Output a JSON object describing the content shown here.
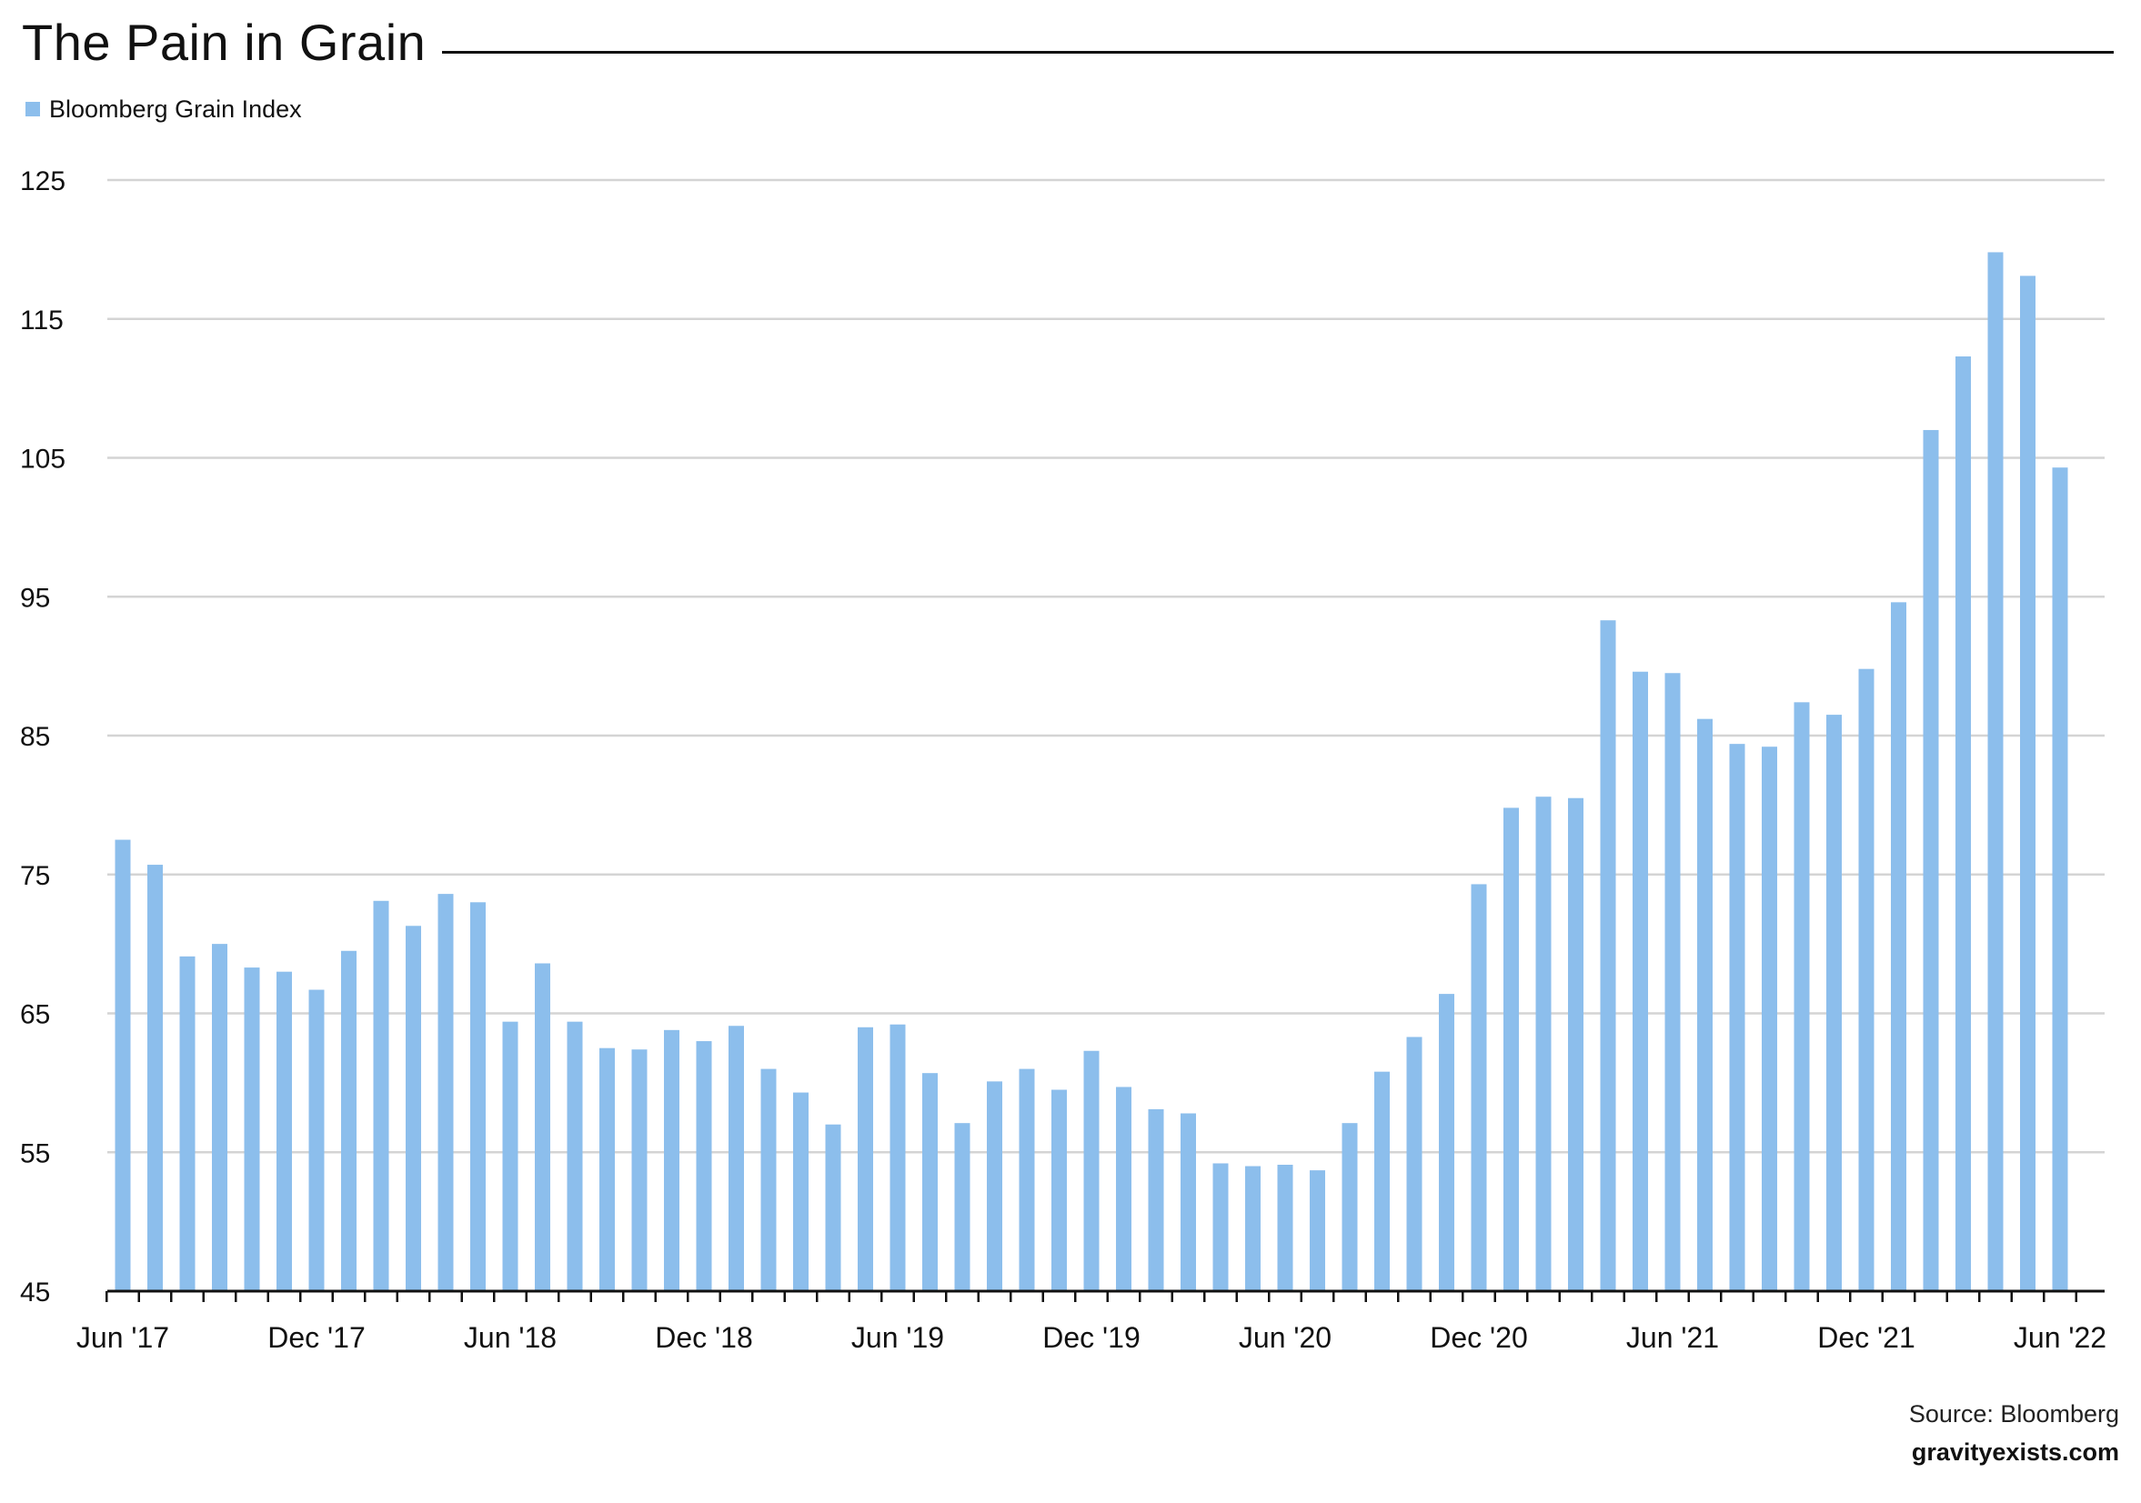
{
  "header": {
    "title": "The Pain in Grain"
  },
  "legend": {
    "label": "Bloomberg Grain Index"
  },
  "footer": {
    "source": "Source: Bloomberg",
    "site": "gravityexists.com"
  },
  "colors": {
    "bar": "#8cbeec",
    "grid": "#d4d4d4",
    "axis": "#111111",
    "text": "#111111"
  },
  "chart_data": {
    "type": "bar",
    "title": "The Pain in Grain",
    "xlabel": "",
    "ylabel": "",
    "ylim": [
      45,
      125
    ],
    "yticks": [
      45,
      55,
      65,
      75,
      85,
      95,
      105,
      115,
      125
    ],
    "grid": true,
    "legend_position": "top-left",
    "categories": [
      "Jun '17",
      "Jul '17",
      "Aug '17",
      "Sep '17",
      "Oct '17",
      "Nov '17",
      "Dec '17",
      "Jan '18",
      "Feb '18",
      "Mar '18",
      "Apr '18",
      "May '18",
      "Jun '18",
      "Jul '18",
      "Aug '18",
      "Sep '18",
      "Oct '18",
      "Nov '18",
      "Dec '18",
      "Jan '19",
      "Feb '19",
      "Mar '19",
      "Apr '19",
      "May '19",
      "Jun '19",
      "Jul '19",
      "Aug '19",
      "Sep '19",
      "Oct '19",
      "Nov '19",
      "Dec '19",
      "Jan '20",
      "Feb '20",
      "Mar '20",
      "Apr '20",
      "May '20",
      "Jun '20",
      "Jul '20",
      "Aug '20",
      "Sep '20",
      "Oct '20",
      "Nov '20",
      "Dec '20",
      "Jan '21",
      "Feb '21",
      "Mar '21",
      "Apr '21",
      "May '21",
      "Jun '21",
      "Jul '21",
      "Aug '21",
      "Sep '21",
      "Oct '21",
      "Nov '21",
      "Dec '21",
      "Jan '22",
      "Feb '22",
      "Mar '22",
      "Apr '22",
      "May '22",
      "Jun '22"
    ],
    "x_tick_labels": [
      {
        "index": 0,
        "label": "Jun '17"
      },
      {
        "index": 6,
        "label": "Dec '17"
      },
      {
        "index": 12,
        "label": "Jun '18"
      },
      {
        "index": 18,
        "label": "Dec '18"
      },
      {
        "index": 24,
        "label": "Jun '19"
      },
      {
        "index": 30,
        "label": "Dec '19"
      },
      {
        "index": 36,
        "label": "Jun '20"
      },
      {
        "index": 42,
        "label": "Dec '20"
      },
      {
        "index": 48,
        "label": "Jun '21"
      },
      {
        "index": 54,
        "label": "Dec '21"
      },
      {
        "index": 60,
        "label": "Jun '22"
      }
    ],
    "series": [
      {
        "name": "Bloomberg Grain Index",
        "values": [
          77.5,
          75.7,
          69.1,
          70.0,
          68.3,
          68.0,
          66.7,
          69.5,
          73.1,
          71.3,
          73.6,
          73.0,
          64.4,
          68.6,
          64.4,
          62.5,
          62.4,
          63.8,
          63.0,
          64.1,
          61.0,
          59.3,
          57.0,
          64.0,
          64.2,
          60.7,
          57.1,
          60.1,
          61.0,
          59.5,
          62.3,
          59.7,
          58.1,
          57.8,
          54.2,
          54.0,
          54.1,
          53.7,
          57.1,
          60.8,
          63.3,
          66.4,
          74.3,
          79.8,
          80.6,
          80.5,
          93.3,
          89.6,
          89.5,
          86.2,
          84.4,
          84.2,
          87.4,
          86.5,
          89.8,
          94.6,
          107.0,
          112.3,
          119.8,
          118.1,
          104.3
        ]
      }
    ]
  }
}
